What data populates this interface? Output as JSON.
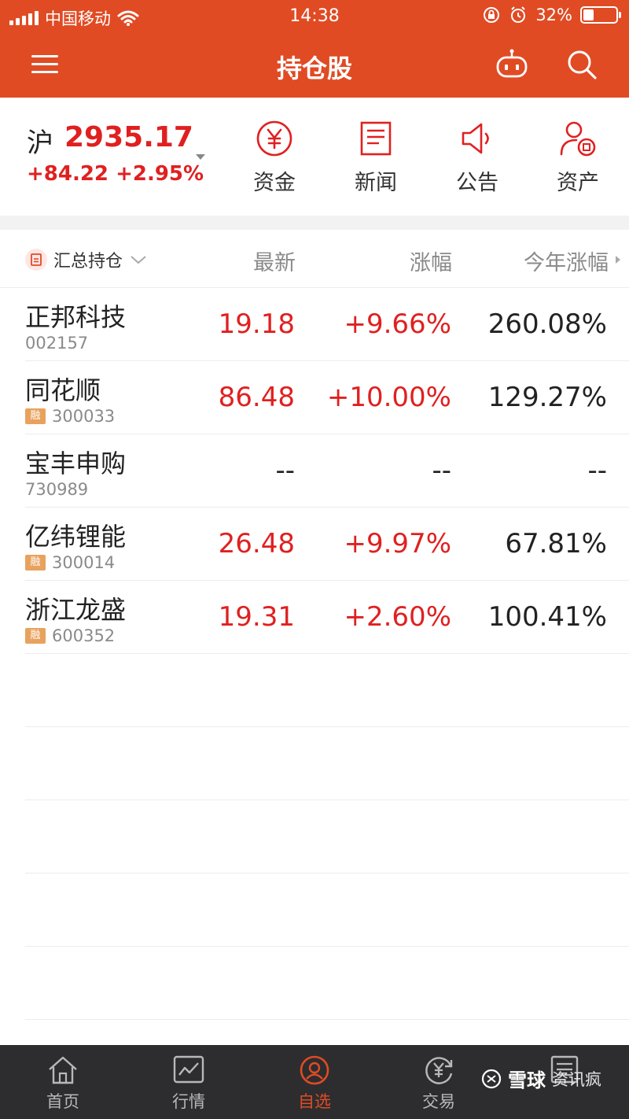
{
  "status_bar": {
    "carrier": "中国移动",
    "time": "14:38",
    "battery": "32%",
    "battery_level": 0.32
  },
  "navbar": {
    "title": "持仓股",
    "icons": [
      "menu-icon",
      "robot-icon",
      "search-icon"
    ]
  },
  "index": {
    "name": "沪",
    "value": "2935.17",
    "change": "+84.22 +2.95%"
  },
  "quick_actions": [
    {
      "label": "资金",
      "icon": "yen-circle-icon"
    },
    {
      "label": "新闻",
      "icon": "document-icon"
    },
    {
      "label": "公告",
      "icon": "speaker-icon"
    },
    {
      "label": "资产",
      "icon": "user-asset-icon"
    }
  ],
  "table": {
    "group_selector": "汇总持仓",
    "columns": [
      "最新",
      "涨幅",
      "今年涨幅"
    ],
    "rows": [
      {
        "name": "正邦科技",
        "code": "002157",
        "margin": "",
        "price": "19.18",
        "change": "+9.66%",
        "ytd": "260.08%"
      },
      {
        "name": "同花顺",
        "code": "300033",
        "margin": "融",
        "price": "86.48",
        "change": "+10.00%",
        "ytd": "129.27%"
      },
      {
        "name": "宝丰申购",
        "code": "730989",
        "margin": "",
        "price": "--",
        "change": "--",
        "ytd": "--"
      },
      {
        "name": "亿纬锂能",
        "code": "300014",
        "margin": "融",
        "price": "26.48",
        "change": "+9.97%",
        "ytd": "67.81%"
      },
      {
        "name": "浙江龙盛",
        "code": "600352",
        "margin": "融",
        "price": "19.31",
        "change": "+2.60%",
        "ytd": "100.41%"
      }
    ]
  },
  "tabbar": {
    "items": [
      {
        "label": "首页",
        "icon": "home-icon"
      },
      {
        "label": "行情",
        "icon": "chart-icon"
      },
      {
        "label": "自选",
        "icon": "watchlist-icon",
        "active": true
      },
      {
        "label": "交易",
        "icon": "trade-icon"
      },
      {
        "label": "",
        "icon": "news-icon"
      }
    ]
  },
  "watermark": {
    "brand": "雪球",
    "user": "资讯疯"
  },
  "colors": {
    "brand": "#e04b24",
    "up": "#e02020",
    "text_secondary": "#8a8a8a",
    "tabbar_bg": "#2d2d2f",
    "margin_badge": "#e8a25d"
  }
}
